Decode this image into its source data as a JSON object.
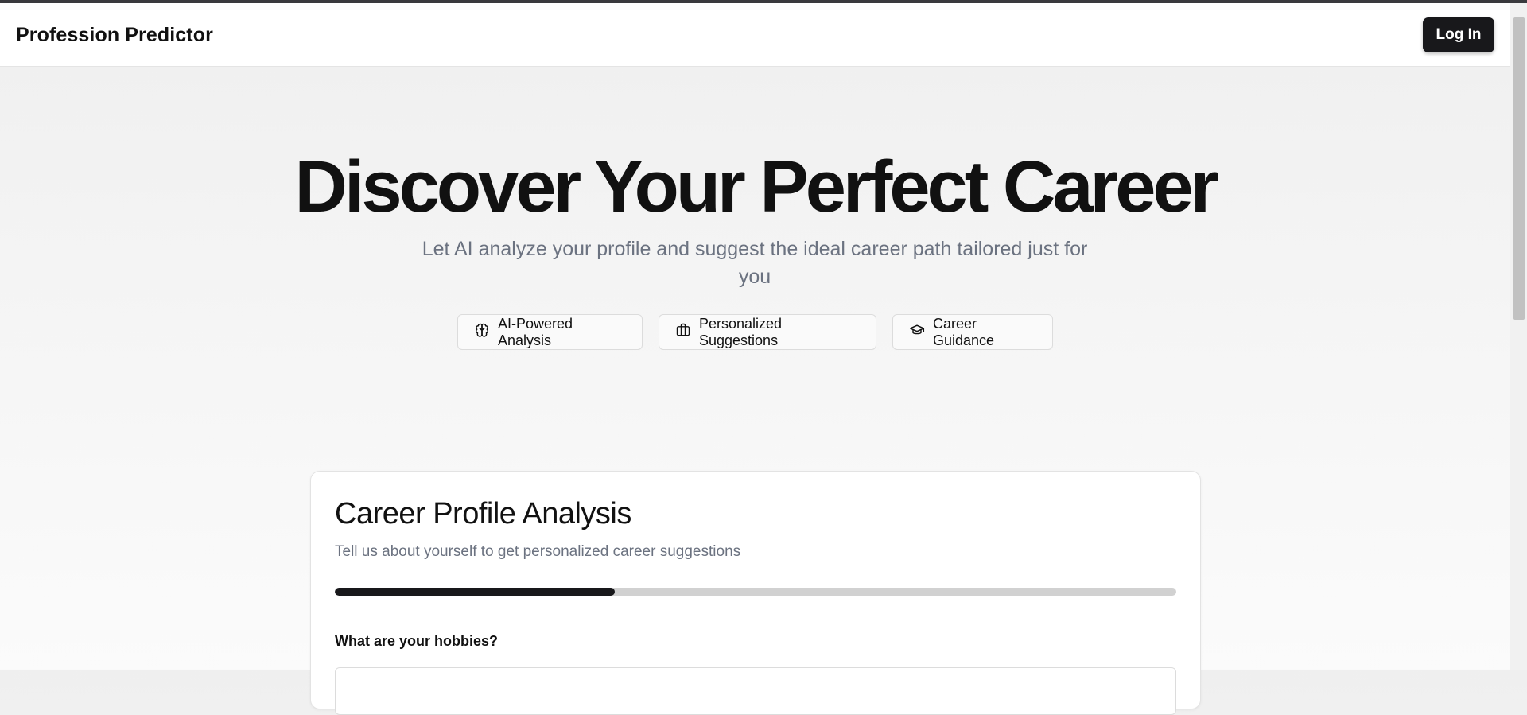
{
  "header": {
    "brand": "Profession Predictor",
    "login_label": "Log In"
  },
  "hero": {
    "title": "Discover Your Perfect Career",
    "subtitle": "Let AI analyze your profile and suggest the ideal career path tailored just for you"
  },
  "features": [
    {
      "label": "AI-Powered Analysis",
      "icon": "brain-icon"
    },
    {
      "label": "Personalized Suggestions",
      "icon": "briefcase-icon"
    },
    {
      "label": "Career Guidance",
      "icon": "graduation-cap-icon"
    }
  ],
  "form": {
    "title": "Career Profile Analysis",
    "subtitle": "Tell us about yourself to get personalized career suggestions",
    "progress_percent": 33.3,
    "question": "What are your hobbies?"
  },
  "colors": {
    "primary": "#18181b",
    "muted_text": "#6b7280",
    "progress_track": "#d1d1d1"
  }
}
